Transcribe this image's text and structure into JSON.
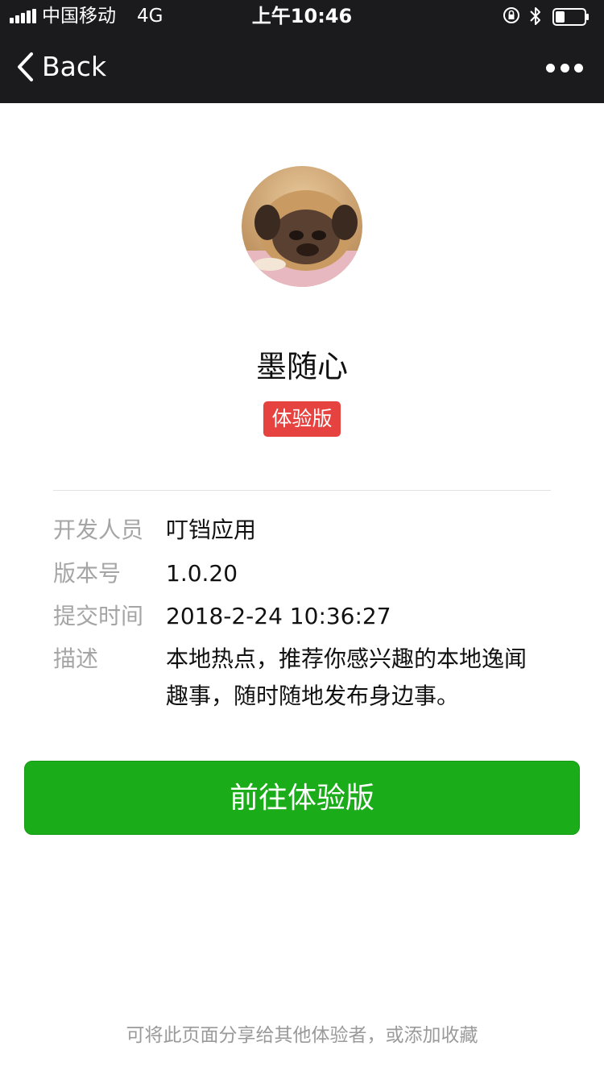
{
  "status_bar": {
    "carrier": "中国移动",
    "network": "4G",
    "time": "上午10:46"
  },
  "nav": {
    "back_label": "Back"
  },
  "app": {
    "name": "墨随心",
    "badge": "体验版"
  },
  "info": [
    {
      "label": "开发人员",
      "value": "叮铛应用"
    },
    {
      "label": "版本号",
      "value": "1.0.20"
    },
    {
      "label": "提交时间",
      "value": "2018-2-24 10:36:27"
    },
    {
      "label": "描述",
      "value": "本地热点，推荐你感兴趣的本地逸闻趣事，随时随地发布身边事。"
    }
  ],
  "primary_button": "前往体验版",
  "footer_text": "可将此页面分享给其他体验者，或添加收藏",
  "colors": {
    "topbar": "#1b1b1d",
    "badge": "#e64340",
    "primary": "#1aad19"
  }
}
